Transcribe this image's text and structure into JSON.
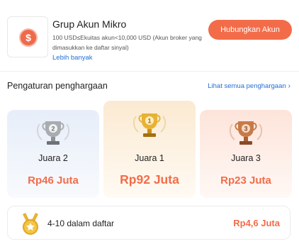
{
  "header": {
    "logo_icon": "dollar-coin-icon",
    "logo_symbol": "$",
    "title": "Grup Akun Mikro",
    "description": "100 USD≤Ekuitas akun<10,000 USD (Akun broker yang dimasukkan ke daftar sinyal)",
    "more_link": "Lebih banyak",
    "connect_button": "Hubungkan Akun"
  },
  "rewards": {
    "section_title": "Pengaturan penghargaan",
    "see_all": "Lihat semua penghargaan",
    "see_all_icon": "chevron-right-icon",
    "podium": [
      {
        "rank_number": "2",
        "label": "Juara 2",
        "prize": "Rp46 Juta",
        "trophy_icon": "silver-trophy-icon"
      },
      {
        "rank_number": "1",
        "label": "Juara 1",
        "prize": "Rp92 Juta",
        "trophy_icon": "gold-trophy-icon"
      },
      {
        "rank_number": "3",
        "label": "Juara 3",
        "prize": "Rp23 Juta",
        "trophy_icon": "bronze-trophy-icon"
      }
    ],
    "list_tier": {
      "label": "4-10 dalam daftar",
      "prize": "Rp4,6 Juta",
      "medal_icon": "medal-icon"
    }
  },
  "colors": {
    "accent": "#f36c49",
    "link": "#1f6fd6",
    "gold": "#e0a72a",
    "silver": "#8e9297",
    "bronze": "#b8683c"
  }
}
